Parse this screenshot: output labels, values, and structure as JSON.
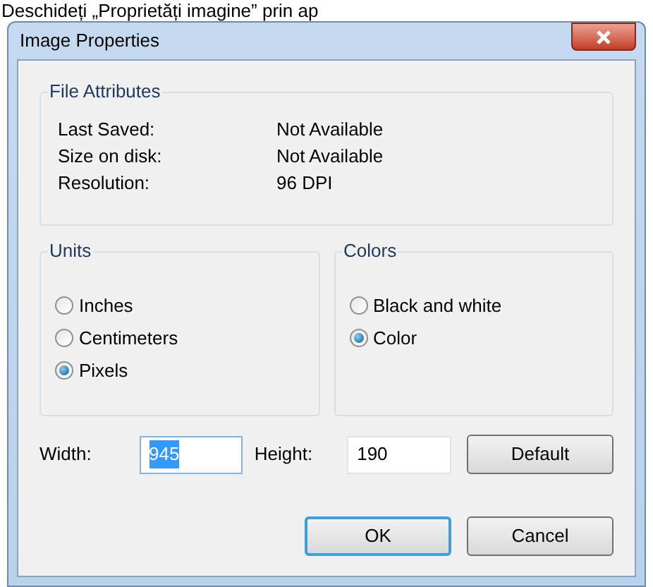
{
  "caption": "Deschideți „Proprietăți imagine” prin ap",
  "window": {
    "title": "Image Properties"
  },
  "file_attributes": {
    "title": "File Attributes",
    "rows": [
      {
        "label": "Last Saved:",
        "value": "Not Available"
      },
      {
        "label": "Size on disk:",
        "value": "Not Available"
      },
      {
        "label": "Resolution:",
        "value": "96 DPI"
      }
    ]
  },
  "units": {
    "title": "Units",
    "options": [
      {
        "label": "Inches",
        "selected": false
      },
      {
        "label": "Centimeters",
        "selected": false
      },
      {
        "label": "Pixels",
        "selected": true
      }
    ]
  },
  "colors": {
    "title": "Colors",
    "options": [
      {
        "label": "Black and white",
        "selected": false
      },
      {
        "label": "Color",
        "selected": true
      }
    ]
  },
  "width": {
    "label": "Width:",
    "value": "945",
    "selected": true
  },
  "height": {
    "label": "Height:",
    "value": "190",
    "selected": false
  },
  "buttons": [
    {
      "label": "Default",
      "kind": "default"
    },
    {
      "label": "OK",
      "kind": "ok"
    },
    {
      "label": "Cancel",
      "kind": "cancel"
    }
  ]
}
